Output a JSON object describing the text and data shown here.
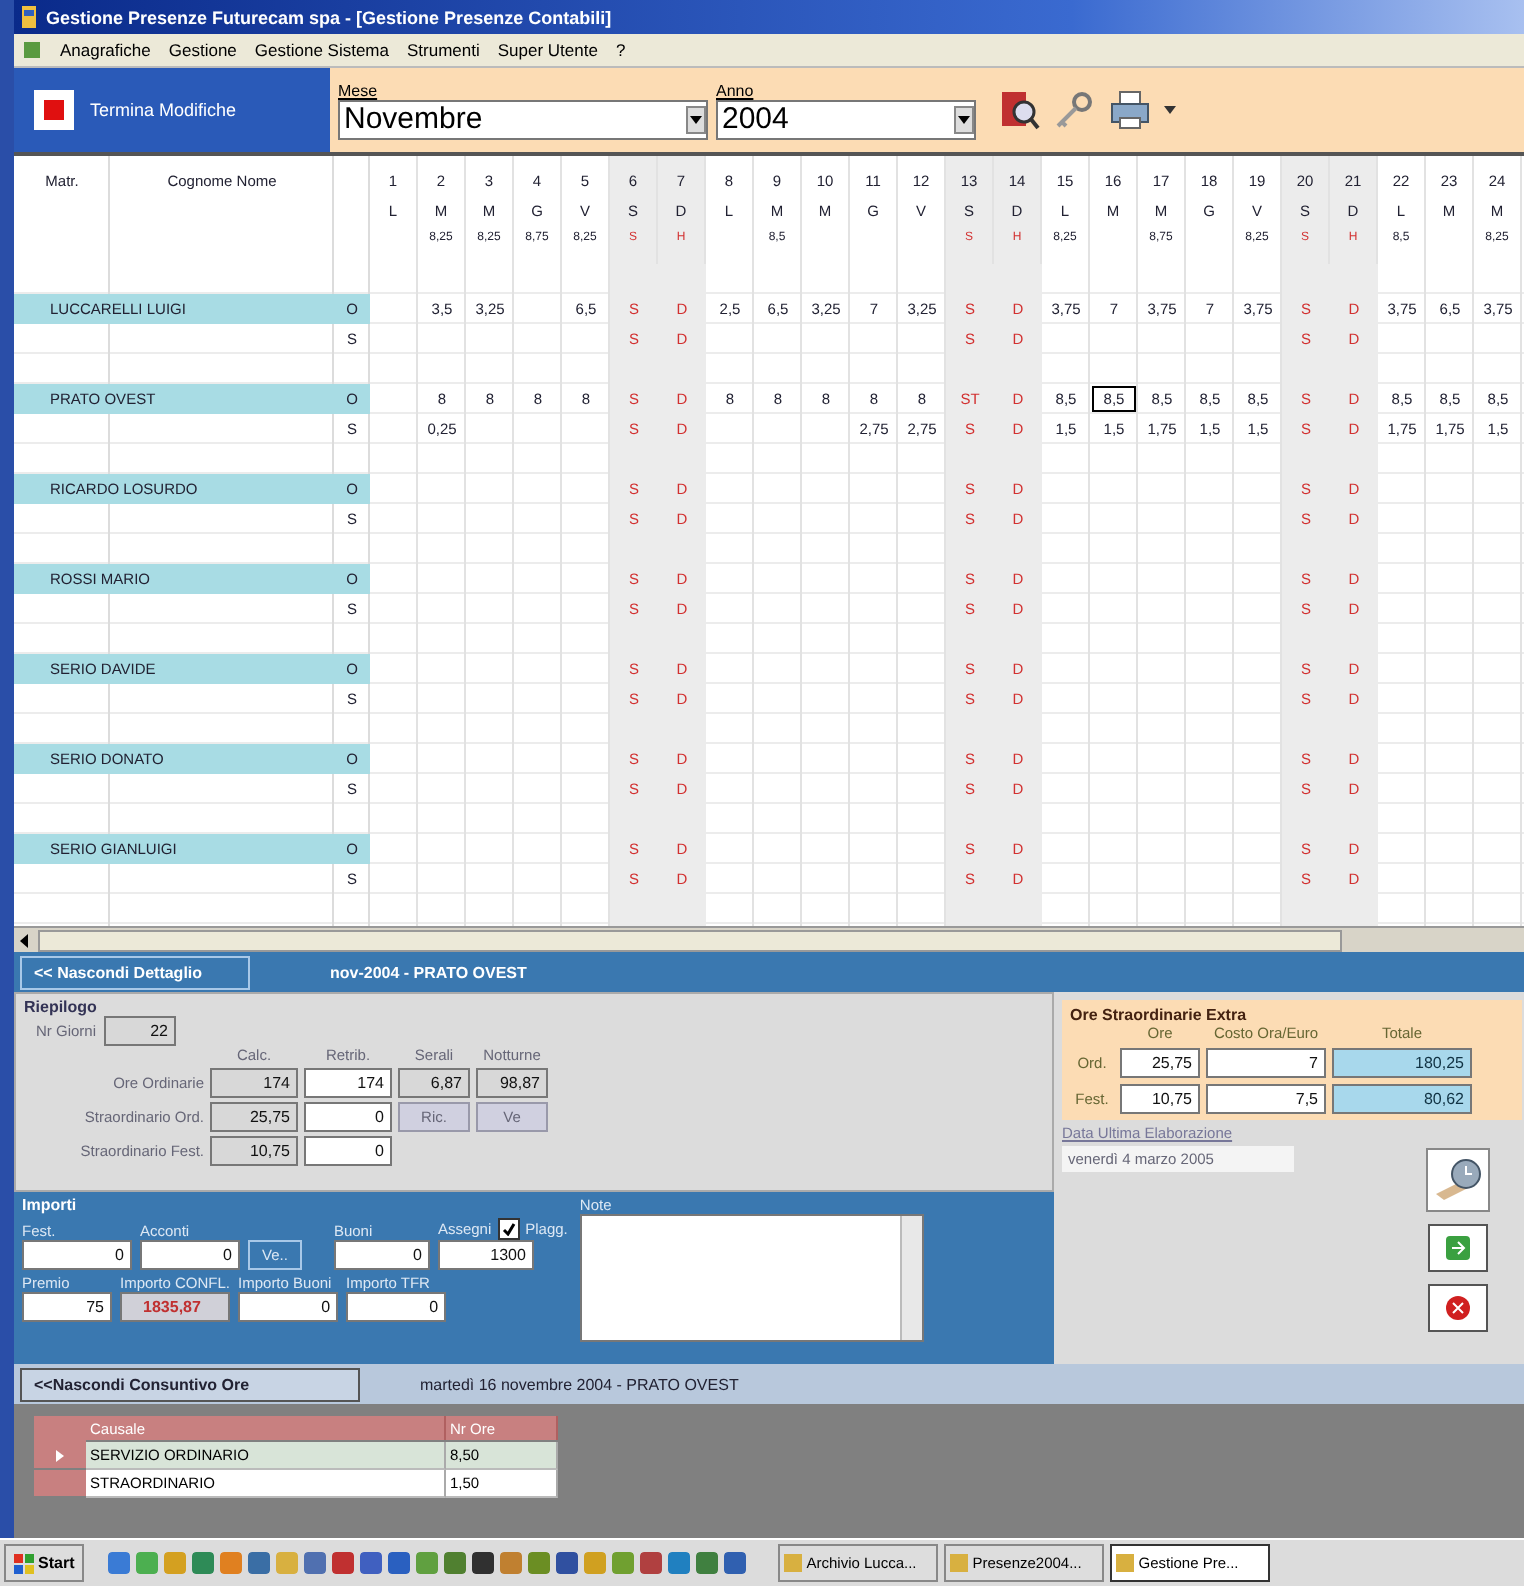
{
  "window": {
    "title": "Gestione Presenze Futurecam spa - [Gestione Presenze Contabili]"
  },
  "menu": [
    "Anagrafiche",
    "Gestione",
    "Gestione Sistema",
    "Strumenti",
    "Super Utente",
    "?"
  ],
  "toolbar": {
    "finish_button": "Termina Modifiche",
    "month_label": "Mese",
    "month": "Novembre",
    "year_label": "Anno",
    "year": "2004"
  },
  "grid": {
    "matr_header": "Matr.",
    "name_header": "Cognome Nome",
    "days": [
      {
        "num": "1",
        "letter": "L",
        "weekend": false
      },
      {
        "num": "2",
        "letter": "M",
        "note": "8,25",
        "weekend": false
      },
      {
        "num": "3",
        "letter": "M",
        "note": "8,25",
        "weekend": false
      },
      {
        "num": "4",
        "letter": "G",
        "note": "8,75",
        "weekend": false
      },
      {
        "num": "5",
        "letter": "V",
        "note": "8,25",
        "weekend": false
      },
      {
        "num": "6",
        "letter": "S",
        "note": "S",
        "weekend": true
      },
      {
        "num": "7",
        "letter": "D",
        "note": "H",
        "weekend": true
      },
      {
        "num": "8",
        "letter": "L",
        "weekend": false
      },
      {
        "num": "9",
        "letter": "M",
        "note": "8,5",
        "weekend": false
      },
      {
        "num": "10",
        "letter": "M",
        "weekend": false
      },
      {
        "num": "11",
        "letter": "G",
        "weekend": false
      },
      {
        "num": "12",
        "letter": "V",
        "weekend": false
      },
      {
        "num": "13",
        "letter": "S",
        "note": "S",
        "weekend": true
      },
      {
        "num": "14",
        "letter": "D",
        "note": "H",
        "weekend": true
      },
      {
        "num": "15",
        "letter": "L",
        "note": "8,25",
        "weekend": false
      },
      {
        "num": "16",
        "letter": "M",
        "weekend": false
      },
      {
        "num": "17",
        "letter": "M",
        "note": "8,75",
        "weekend": false
      },
      {
        "num": "18",
        "letter": "G",
        "weekend": false
      },
      {
        "num": "19",
        "letter": "V",
        "note": "8,25",
        "weekend": false
      },
      {
        "num": "20",
        "letter": "S",
        "note": "S",
        "weekend": true
      },
      {
        "num": "21",
        "letter": "D",
        "note": "H",
        "weekend": true
      },
      {
        "num": "22",
        "letter": "L",
        "note": "8,5",
        "weekend": false
      },
      {
        "num": "23",
        "letter": "M",
        "weekend": false
      },
      {
        "num": "24",
        "letter": "M",
        "note": "8,25",
        "weekend": false
      }
    ],
    "employees": [
      {
        "name": "LUCCARELLI LUIGI",
        "rows": [
          {
            "code": "O",
            "cells": [
              {},
              {
                "value": "3,5",
                "focused": false
              },
              {
                "value": "3,25",
                "focused": false
              },
              {},
              {
                "value": "6,5",
                "focused": false
              },
              {
                "value": "S",
                "focused": false
              },
              {
                "value": "D",
                "focused": false
              },
              {
                "value": "2,5",
                "focused": false
              },
              {
                "value": "6,5",
                "focused": false
              },
              {
                "value": "3,25",
                "focused": false
              },
              {
                "value": "7",
                "focused": false
              },
              {
                "value": "3,25",
                "focused": false
              },
              {
                "value": "S",
                "focused": false
              },
              {
                "value": "D",
                "focused": false
              },
              {
                "value": "3,75",
                "focused": false
              },
              {
                "value": "7",
                "focused": false
              },
              {
                "value": "3,75",
                "focused": false
              },
              {
                "value": "7",
                "focused": false
              },
              {
                "value": "3,75",
                "focused": false
              },
              {
                "value": "S",
                "focused": false
              },
              {
                "value": "D",
                "focused": false
              },
              {
                "value": "3,75",
                "focused": false
              },
              {
                "value": "6,5",
                "focused": false
              },
              {
                "value": "3,75",
                "focused": false
              }
            ]
          },
          {
            "code": "S",
            "cells": [
              {},
              {},
              {},
              {},
              {},
              {
                "value": "S",
                "focused": false
              },
              {
                "value": "D",
                "focused": false
              },
              {},
              {},
              {},
              {},
              {},
              {
                "value": "S",
                "focused": false
              },
              {
                "value": "D",
                "focused": false
              },
              {},
              {},
              {},
              {},
              {},
              {
                "value": "S",
                "focused": false
              },
              {
                "value": "D",
                "focused": false
              }
            ]
          }
        ]
      },
      {
        "name": "PRATO OVEST",
        "rows": [
          {
            "code": "O",
            "cells": [
              {},
              {
                "value": "8",
                "focused": false
              },
              {
                "value": "8",
                "focused": false
              },
              {
                "value": "8",
                "focused": false
              },
              {
                "value": "8",
                "focused": false
              },
              {
                "value": "S",
                "focused": false
              },
              {
                "value": "D",
                "focused": false
              },
              {
                "value": "8",
                "focused": false
              },
              {
                "value": "8",
                "focused": false
              },
              {
                "value": "8",
                "focused": false
              },
              {
                "value": "8",
                "focused": false
              },
              {
                "value": "8",
                "focused": false
              },
              {
                "value": "ST",
                "focused": false
              },
              {
                "value": "D",
                "focused": false
              },
              {
                "value": "8,5",
                "focused": false
              },
              {
                "value": "8,5",
                "focused": true
              },
              {
                "value": "8,5",
                "focused": false
              },
              {
                "value": "8,5",
                "focused": false
              },
              {
                "value": "8,5",
                "focused": false
              },
              {
                "value": "S",
                "focused": false
              },
              {
                "value": "D",
                "focused": false
              },
              {
                "value": "8,5",
                "focused": false
              },
              {
                "value": "8,5",
                "focused": false
              },
              {
                "value": "8,5",
                "focused": false
              }
            ]
          },
          {
            "code": "S",
            "cells": [
              {},
              {
                "value": "0,25",
                "focused": false
              },
              {},
              {},
              {},
              {
                "value": "S",
                "focused": false
              },
              {
                "value": "D",
                "focused": false
              },
              {},
              {},
              {},
              {
                "value": "2,75",
                "focused": false
              },
              {
                "value": "2,75",
                "focused": false
              },
              {
                "value": "S",
                "focused": false
              },
              {
                "value": "D",
                "focused": false
              },
              {
                "value": "1,5",
                "focused": false
              },
              {
                "value": "1,5",
                "focused": false
              },
              {
                "value": "1,75",
                "focused": false
              },
              {
                "value": "1,5",
                "focused": false
              },
              {
                "value": "1,5",
                "focused": false
              },
              {
                "value": "S",
                "focused": false
              },
              {
                "value": "D",
                "focused": false
              },
              {
                "value": "1,75",
                "focused": false
              },
              {
                "value": "1,75",
                "focused": false
              },
              {
                "value": "1,5",
                "focused": false
              }
            ]
          }
        ]
      },
      {
        "name": "RICARDO LOSURDO",
        "rows": [
          {
            "code": "O",
            "cells": [
              {},
              {},
              {},
              {},
              {},
              {
                "value": "S",
                "focused": false
              },
              {
                "value": "D",
                "focused": false
              },
              {},
              {},
              {},
              {},
              {},
              {
                "value": "S",
                "focused": false
              },
              {
                "value": "D",
                "focused": false
              },
              {},
              {},
              {},
              {},
              {},
              {
                "value": "S",
                "focused": false
              },
              {
                "value": "D",
                "focused": false
              }
            ]
          },
          {
            "code": "S",
            "cells": [
              {},
              {},
              {},
              {},
              {},
              {
                "value": "S",
                "focused": false
              },
              {
                "value": "D",
                "focused": false
              },
              {},
              {},
              {},
              {},
              {},
              {
                "value": "S",
                "focused": false
              },
              {
                "value": "D",
                "focused": false
              },
              {},
              {},
              {},
              {},
              {},
              {
                "value": "S",
                "focused": false
              },
              {
                "value": "D",
                "focused": false
              }
            ]
          }
        ]
      },
      {
        "name": "ROSSI MARIO",
        "rows": [
          {
            "code": "O",
            "cells": [
              {},
              {},
              {},
              {},
              {},
              {
                "value": "S",
                "focused": false
              },
              {
                "value": "D",
                "focused": false
              },
              {},
              {},
              {},
              {},
              {},
              {
                "value": "S",
                "focused": false
              },
              {
                "value": "D",
                "focused": false
              },
              {},
              {},
              {},
              {},
              {},
              {
                "value": "S",
                "focused": false
              },
              {
                "value": "D",
                "focused": false
              }
            ]
          },
          {
            "code": "S",
            "cells": [
              {},
              {},
              {},
              {},
              {},
              {
                "value": "S",
                "focused": false
              },
              {
                "value": "D",
                "focused": false
              },
              {},
              {},
              {},
              {},
              {},
              {
                "value": "S",
                "focused": false
              },
              {
                "value": "D",
                "focused": false
              },
              {},
              {},
              {},
              {},
              {},
              {
                "value": "S",
                "focused": false
              },
              {
                "value": "D",
                "focused": false
              }
            ]
          }
        ]
      },
      {
        "name": "SERIO DAVIDE",
        "rows": [
          {
            "code": "O",
            "cells": [
              {},
              {},
              {},
              {},
              {},
              {
                "value": "S",
                "focused": false
              },
              {
                "value": "D",
                "focused": false
              },
              {},
              {},
              {},
              {},
              {},
              {
                "value": "S",
                "focused": false
              },
              {
                "value": "D",
                "focused": false
              },
              {},
              {},
              {},
              {},
              {},
              {
                "value": "S",
                "focused": false
              },
              {
                "value": "D",
                "focused": false
              }
            ]
          },
          {
            "code": "S",
            "cells": [
              {},
              {},
              {},
              {},
              {},
              {
                "value": "S",
                "focused": false
              },
              {
                "value": "D",
                "focused": false
              },
              {},
              {},
              {},
              {},
              {},
              {
                "value": "S",
                "focused": false
              },
              {
                "value": "D",
                "focused": false
              },
              {},
              {},
              {},
              {},
              {},
              {
                "value": "S",
                "focused": false
              },
              {
                "value": "D",
                "focused": false
              }
            ]
          }
        ]
      },
      {
        "name": "SERIO DONATO",
        "rows": [
          {
            "code": "O",
            "cells": [
              {},
              {},
              {},
              {},
              {},
              {
                "value": "S",
                "focused": false
              },
              {
                "value": "D",
                "focused": false
              },
              {},
              {},
              {},
              {},
              {},
              {
                "value": "S",
                "focused": false
              },
              {
                "value": "D",
                "focused": false
              },
              {},
              {},
              {},
              {},
              {},
              {
                "value": "S",
                "focused": false
              },
              {
                "value": "D",
                "focused": false
              }
            ]
          },
          {
            "code": "S",
            "cells": [
              {},
              {},
              {},
              {},
              {},
              {
                "value": "S",
                "focused": false
              },
              {
                "value": "D",
                "focused": false
              },
              {},
              {},
              {},
              {},
              {},
              {
                "value": "S",
                "focused": false
              },
              {
                "value": "D",
                "focused": false
              },
              {},
              {},
              {},
              {},
              {},
              {
                "value": "S",
                "focused": false
              },
              {
                "value": "D",
                "focused": false
              }
            ]
          }
        ]
      },
      {
        "name": "SERIO GIANLUIGI",
        "rows": [
          {
            "code": "O",
            "cells": [
              {},
              {},
              {},
              {},
              {},
              {
                "value": "S",
                "focused": false
              },
              {
                "value": "D",
                "focused": false
              },
              {},
              {},
              {},
              {},
              {},
              {
                "value": "S",
                "focused": false
              },
              {
                "value": "D",
                "focused": false
              },
              {},
              {},
              {},
              {},
              {},
              {
                "value": "S",
                "focused": false
              },
              {
                "value": "D",
                "focused": false
              }
            ]
          },
          {
            "code": "S",
            "cells": [
              {},
              {},
              {},
              {},
              {},
              {
                "value": "S",
                "focused": false
              },
              {
                "value": "D",
                "focused": false
              },
              {},
              {},
              {},
              {},
              {},
              {
                "value": "S",
                "focused": false
              },
              {
                "value": "D",
                "focused": false
              },
              {},
              {},
              {},
              {},
              {},
              {
                "value": "S",
                "focused": false
              },
              {
                "value": "D",
                "focused": false
              }
            ]
          }
        ]
      }
    ]
  },
  "detail": {
    "toggle_button": "<< Nascondi Dettaglio",
    "caption": "nov-2004 - PRATO OVEST"
  },
  "riepilogo": {
    "title": "Riepilogo",
    "days_label": "Nr Giorni",
    "days": "22",
    "columns": [
      "Calc.",
      "Retrib.",
      "Serali",
      "Notturne"
    ],
    "rows": [
      {
        "label": "Ore Ordinarie",
        "cells": [
          {
            "kind": "field",
            "value": "174",
            "readonly": true
          },
          {
            "kind": "field",
            "value": "174",
            "readonly": false
          },
          {
            "kind": "field",
            "value": "6,87",
            "readonly": true
          },
          {
            "kind": "field",
            "value": "98,87",
            "readonly": true
          }
        ]
      },
      {
        "label": "Straordinario Ord.",
        "cells": [
          {
            "kind": "field",
            "value": "25,75",
            "readonly": true
          },
          {
            "kind": "field",
            "value": "0",
            "readonly": false
          },
          {
            "kind": "button",
            "value": "Ric."
          },
          {
            "kind": "button",
            "value": "Ve"
          }
        ]
      },
      {
        "label": "Straordinario Fest.",
        "cells": [
          {
            "kind": "field",
            "value": "10,75",
            "readonly": true
          },
          {
            "kind": "field",
            "value": "0",
            "readonly": false
          }
        ]
      }
    ]
  },
  "extra": {
    "title": "Ore Straordinarie Extra",
    "columns": [
      "Ore",
      "Costo Ora/Euro",
      "Totale"
    ],
    "rows": [
      {
        "label": "Ord.",
        "hours": "25,75",
        "cost": "7",
        "total": "180,25"
      },
      {
        "label": "Fest.",
        "hours": "10,75",
        "cost": "7,5",
        "total": "80,62"
      }
    ],
    "last_run_label": "Data Ultima Elaborazione",
    "last_run": "venerdì 4 marzo 2005"
  },
  "importi": {
    "title": "Importi",
    "fest_label": "Fest.",
    "fest": "0",
    "acconti_label": "Acconti",
    "acconti": "0",
    "ve_button": "Ve..",
    "buoni_label": "Buoni",
    "buoni": "0",
    "assegni_label": "Assegni",
    "plagg_label": "Plagg.",
    "plagg_checked": true,
    "assegni": "1300",
    "premio_label": "Premio",
    "premio": "75",
    "confl_label": "Importo CONFL.",
    "confl": "1835,87",
    "buoni_amount_label": "Importo Buoni",
    "buoni_amount": "0",
    "tfr_label": "Importo TFR",
    "tfr": "0",
    "note_label": "Note"
  },
  "consuntivo": {
    "toggle_button": "<<Nascondi Consuntivo Ore",
    "caption": "martedì 16 novembre 2004 - PRATO OVEST",
    "columns": [
      "Causale",
      "Nr Ore"
    ],
    "rows": [
      {
        "causale": "SERVIZIO ORDINARIO",
        "hours": "8,50",
        "selected": true
      },
      {
        "causale": "STRAORDINARIO",
        "hours": "1,50",
        "selected": false
      }
    ]
  },
  "taskbar": {
    "start": "Start",
    "tasks": [
      {
        "label": "Archivio Lucca...",
        "selected": false
      },
      {
        "label": "Presenze2004...",
        "selected": false
      },
      {
        "label": "Gestione Pre...",
        "selected": true
      }
    ]
  }
}
